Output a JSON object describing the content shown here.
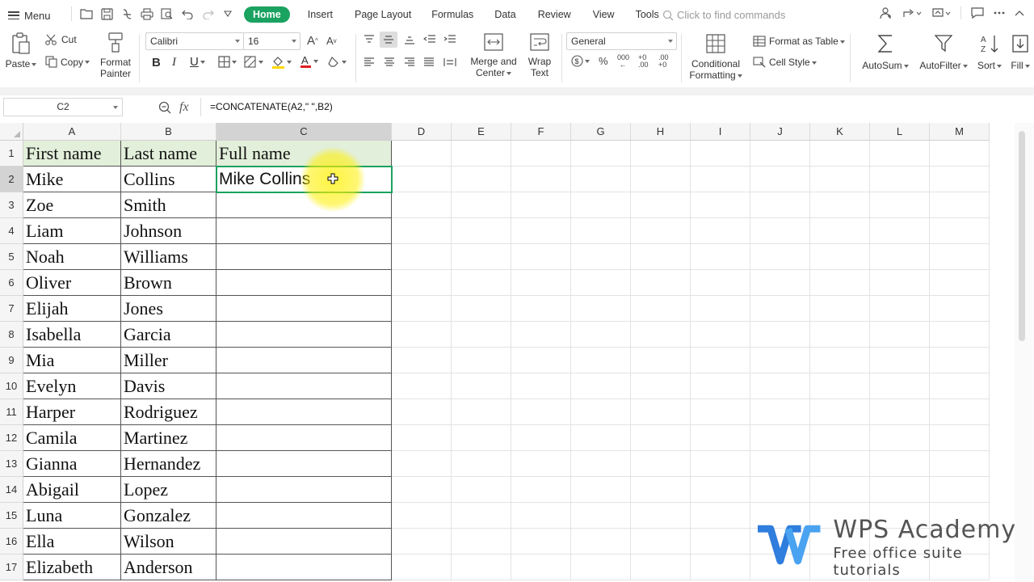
{
  "menubar": {
    "menu_label": "Menu",
    "tabs": [
      "Home",
      "Insert",
      "Page Layout",
      "Formulas",
      "Data",
      "Review",
      "View",
      "Tools"
    ],
    "search_placeholder": "Click to find commands"
  },
  "ribbon": {
    "paste": "Paste",
    "cut": "Cut",
    "copy": "Copy",
    "format_painter_1": "Format",
    "format_painter_2": "Painter",
    "font_name": "Calibri",
    "font_size": "16",
    "merge_1": "Merge and",
    "merge_2": "Center",
    "wrap_1": "Wrap",
    "wrap_2": "Text",
    "number_format": "General",
    "conditional_1": "Conditional",
    "conditional_2": "Formatting",
    "format_as_table": "Format as Table",
    "cell_style": "Cell Style",
    "autosum": "AutoSum",
    "autofilter": "AutoFilter",
    "sort": "Sort",
    "fill": "Fill",
    "bold": "B",
    "italic": "I",
    "underline": "U",
    "fx": "fx"
  },
  "formula_bar": {
    "cell_ref": "C2",
    "formula": "=CONCATENATE(A2,\" \",B2)"
  },
  "sheet": {
    "columns": [
      "A",
      "B",
      "C",
      "D",
      "E",
      "F",
      "G",
      "H",
      "I",
      "J",
      "K",
      "L",
      "M"
    ],
    "rows": [
      [
        "First name",
        "Last name",
        "Full name"
      ],
      [
        "Mike",
        "Collins",
        "Mike Collins"
      ],
      [
        "Zoe",
        "Smith",
        ""
      ],
      [
        "Liam",
        "Johnson",
        ""
      ],
      [
        "Noah",
        "Williams",
        ""
      ],
      [
        "Oliver",
        "Brown",
        ""
      ],
      [
        "Elijah",
        "Jones",
        ""
      ],
      [
        "Isabella",
        "Garcia",
        ""
      ],
      [
        "Mia",
        "Miller",
        ""
      ],
      [
        "Evelyn",
        "Davis",
        ""
      ],
      [
        "Harper",
        "Rodriguez",
        ""
      ],
      [
        "Camila",
        "Martinez",
        ""
      ],
      [
        "Gianna",
        "Hernandez",
        ""
      ],
      [
        "Abigail",
        "Lopez",
        ""
      ],
      [
        "Luna",
        "Gonzalez",
        ""
      ],
      [
        "Ella",
        "Wilson",
        ""
      ],
      [
        "Elizabeth",
        "Anderson",
        ""
      ]
    ],
    "row_numbers": [
      "1",
      "2",
      "3",
      "4",
      "5",
      "6",
      "7",
      "8",
      "9",
      "10",
      "11",
      "12",
      "13",
      "14",
      "15",
      "16",
      "17"
    ]
  },
  "watermark": {
    "title": "WPS Academy",
    "subtitle": "Free office suite tutorials"
  },
  "colors": {
    "accent": "#1aa260",
    "header_fill": "#e2efda",
    "cursor_highlight": "#fff000"
  }
}
